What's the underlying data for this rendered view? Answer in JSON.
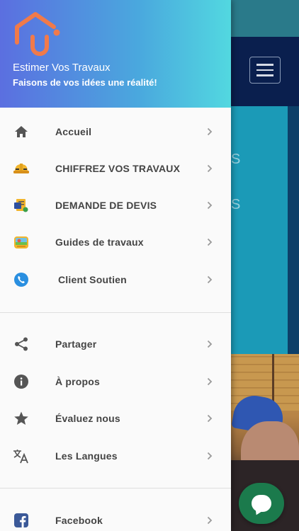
{
  "app": {
    "title": "Estimer Vos Travaux",
    "subtitle": "Faisons de vos idées une réalité!"
  },
  "menu_primary": [
    {
      "label": "Accueil",
      "icon": "home-icon"
    },
    {
      "label": "CHIFFREZ VOS TRAVAUX",
      "icon": "hard-hat-icon"
    },
    {
      "label": "DEMANDE DE DEVIS",
      "icon": "quote-document-icon"
    },
    {
      "label": "Guides de travaux",
      "icon": "guides-icon"
    },
    {
      "label": "Client Soutien",
      "icon": "phone-icon"
    }
  ],
  "menu_secondary": [
    {
      "label": "Partager",
      "icon": "share-icon"
    },
    {
      "label": "À propos",
      "icon": "info-icon"
    },
    {
      "label": "Évaluez nous",
      "icon": "star-icon"
    },
    {
      "label": "Les Langues",
      "icon": "translate-icon"
    }
  ],
  "menu_social": [
    {
      "label": "Facebook",
      "icon": "facebook-icon"
    }
  ],
  "background_text": {
    "line1": "S",
    "line2": "S"
  },
  "colors": {
    "header_gradient_start": "#5b6fe0",
    "header_gradient_end": "#52d8e0",
    "logo_orange": "#f07a4a",
    "accent_teal": "#1b9ab7",
    "navbar_dark": "#0a1f4e",
    "chat_green": "#1b7a4c"
  }
}
